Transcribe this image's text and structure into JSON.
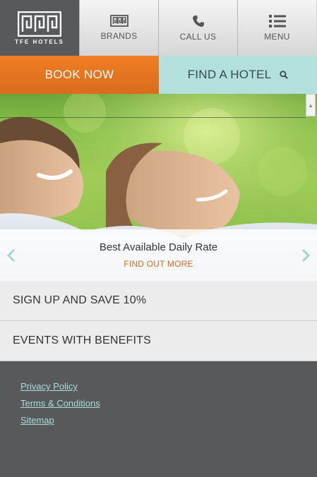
{
  "brand": {
    "logo_text": "TFE HOTELS"
  },
  "nav": [
    {
      "label": "BRANDS",
      "icon": "brands-icon"
    },
    {
      "label": "CALL US",
      "icon": "phone-icon"
    },
    {
      "label": "MENU",
      "icon": "menu-list-icon"
    }
  ],
  "cta": {
    "book_label": "BOOK NOW",
    "find_label": "FIND A HOTEL"
  },
  "hero": {
    "caption_title": "Best Available Daily Rate",
    "caption_link": "FIND OUT MORE"
  },
  "promos": [
    {
      "label": "SIGN UP AND SAVE 10%"
    },
    {
      "label": "EVENTS WITH BENEFITS"
    }
  ],
  "footer": {
    "links": [
      "Privacy Policy",
      "Terms & Conditions",
      "Sitemap"
    ]
  },
  "colors": {
    "orange": "#e8761f",
    "teal": "#b2e0dd",
    "dark": "#58595b",
    "link": "#a9ddd8"
  }
}
